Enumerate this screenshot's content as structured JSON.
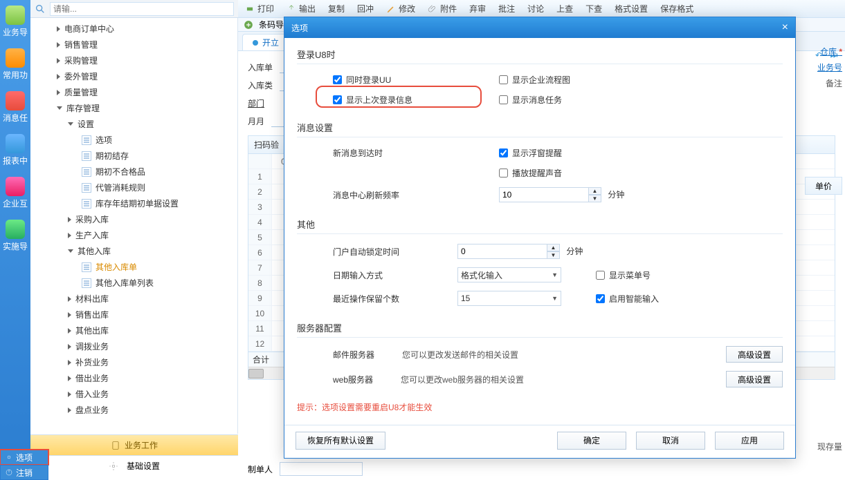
{
  "leftbar": [
    {
      "label": "业务导",
      "cls": "ic-biz"
    },
    {
      "label": "常用功",
      "cls": "ic-star"
    },
    {
      "label": "消息任",
      "cls": "ic-msg"
    },
    {
      "label": "报表中",
      "cls": "ic-rpt"
    },
    {
      "label": "企业互",
      "cls": "ic-grid"
    },
    {
      "label": "实施导",
      "cls": "ic-comp"
    }
  ],
  "search": {
    "placeholder": "请输..."
  },
  "tree": [
    {
      "label": "电商订单中心",
      "type": "branch",
      "indent": 0,
      "open": false
    },
    {
      "label": "销售管理",
      "type": "branch",
      "indent": 0,
      "open": false
    },
    {
      "label": "采购管理",
      "type": "branch",
      "indent": 0,
      "open": false
    },
    {
      "label": "委外管理",
      "type": "branch",
      "indent": 0,
      "open": false
    },
    {
      "label": "质量管理",
      "type": "branch",
      "indent": 0,
      "open": false
    },
    {
      "label": "库存管理",
      "type": "branch",
      "indent": 0,
      "open": true
    },
    {
      "label": "设置",
      "type": "branch",
      "indent": 1,
      "open": true
    },
    {
      "label": "选项",
      "type": "leaf",
      "indent": 2
    },
    {
      "label": "期初结存",
      "type": "leaf",
      "indent": 2
    },
    {
      "label": "期初不合格品",
      "type": "leaf",
      "indent": 2
    },
    {
      "label": "代管消耗规则",
      "type": "leaf",
      "indent": 2
    },
    {
      "label": "库存年结期初单据设置",
      "type": "leaf",
      "indent": 2
    },
    {
      "label": "采购入库",
      "type": "branch",
      "indent": 1,
      "open": false
    },
    {
      "label": "生产入库",
      "type": "branch",
      "indent": 1,
      "open": false
    },
    {
      "label": "其他入库",
      "type": "branch",
      "indent": 1,
      "open": true
    },
    {
      "label": "其他入库单",
      "type": "leaf",
      "indent": 2,
      "sel": true
    },
    {
      "label": "其他入库单列表",
      "type": "leaf",
      "indent": 2
    },
    {
      "label": "材料出库",
      "type": "branch",
      "indent": 1,
      "open": false
    },
    {
      "label": "销售出库",
      "type": "branch",
      "indent": 1,
      "open": false
    },
    {
      "label": "其他出库",
      "type": "branch",
      "indent": 1,
      "open": false
    },
    {
      "label": "调拨业务",
      "type": "branch",
      "indent": 1,
      "open": false
    },
    {
      "label": "补货业务",
      "type": "branch",
      "indent": 1,
      "open": false
    },
    {
      "label": "借出业务",
      "type": "branch",
      "indent": 1,
      "open": false
    },
    {
      "label": "借入业务",
      "type": "branch",
      "indent": 1,
      "open": false
    },
    {
      "label": "盘点业务",
      "type": "branch",
      "indent": 1,
      "open": false
    }
  ],
  "bottom_tabs": {
    "work": "业务工作",
    "base": "基础设置"
  },
  "side_opts": {
    "options": "选项",
    "logout": "注销"
  },
  "toolbar": {
    "print": "打印",
    "output": "输出",
    "copy": "复制",
    "withdraw": "回冲",
    "modify": "修改",
    "attach": "附件",
    "discard": "弃审",
    "batch": "批注",
    "discuss": "讨论",
    "up": "上查",
    "down": "下查",
    "fmt": "格式设置",
    "save": "保存格式"
  },
  "barcode_label": "条码导",
  "tab_open": "开立",
  "form": {
    "f1": "入库单",
    "f2": "入库类",
    "f3": "部门",
    "f4": "月月"
  },
  "grid": {
    "scanhead": "扫码验",
    "first": "0",
    "rows": [
      "1",
      "2",
      "3",
      "4",
      "5",
      "6",
      "7",
      "8",
      "9",
      "10",
      "11",
      "12"
    ],
    "sum": "合计",
    "price": "单价"
  },
  "right": {
    "store": "仓库",
    "bizno": "业务号",
    "remark": "备注",
    "stock": "现存量"
  },
  "page_prev": "↶",
  "page_last": "⏭",
  "footer": {
    "maker": "制单人"
  },
  "modal": {
    "title": "选项",
    "sec_login": "登录U8时",
    "chk_uu": "同时登录UU",
    "chk_last": "显示上次登录信息",
    "chk_flow": "显示企业流程图",
    "chk_msgtask": "显示消息任务",
    "sec_msg": "消息设置",
    "lbl_newmsg": "新消息到达时",
    "chk_float": "显示浮窗提醒",
    "chk_sound": "播放提醒声音",
    "lbl_refresh": "消息中心刷新频率",
    "val_refresh": "10",
    "unit_refresh": "分钟",
    "sec_other": "其他",
    "lbl_lock": "门户自动锁定时间",
    "val_lock": "0",
    "unit_lock": "分钟",
    "lbl_dateinput": "日期输入方式",
    "val_dateinput": "格式化输入",
    "lbl_keep": "最近操作保留个数",
    "val_keep": "15",
    "chk_menu": "显示菜单号",
    "chk_smart": "启用智能输入",
    "sec_srv": "服务器配置",
    "srv_mail": "邮件服务器",
    "srv_mail_desc": "您可以更改发送邮件的相关设置",
    "srv_web": "web服务器",
    "srv_web_desc": "您可以更改web服务器的相关设置",
    "adv": "高级设置",
    "tip": "提示：选项设置需要重启U8才能生效",
    "btn_restore": "恢复所有默认设置",
    "btn_ok": "确定",
    "btn_cancel": "取消",
    "btn_apply": "应用"
  },
  "checks": {
    "uu": true,
    "last": true,
    "flow": false,
    "msgtask": false,
    "float": true,
    "sound": false,
    "menu": false,
    "smart": true
  }
}
